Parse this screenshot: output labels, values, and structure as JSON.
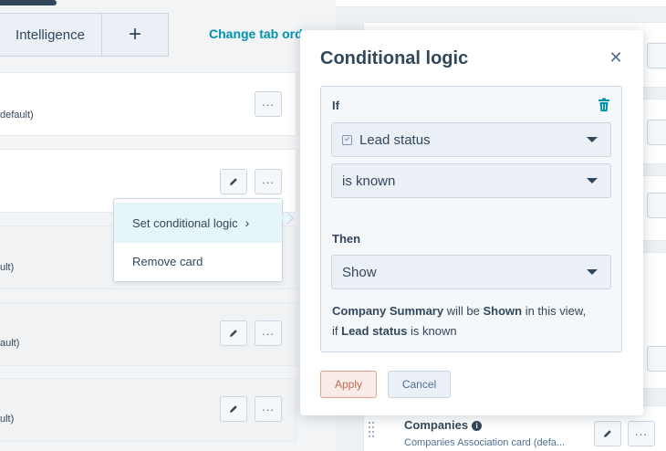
{
  "tabs": {
    "intelligence_label": "Intelligence",
    "add_label": "+",
    "change_order_label": "Change tab order"
  },
  "left_cards": [
    {
      "subtitle": "default)"
    },
    {
      "subtitle": ""
    },
    {
      "subtitle": "ult)"
    },
    {
      "subtitle": "ault)"
    },
    {
      "subtitle": "ult)"
    }
  ],
  "context_menu": {
    "items": [
      {
        "label": "Set conditional logic",
        "chevron": "›"
      },
      {
        "label": "Remove card"
      }
    ]
  },
  "dialog": {
    "title": "Conditional logic",
    "close_icon": "close-icon",
    "if_label": "If",
    "property_select": "Lead status",
    "condition_select": "is known",
    "then_label": "Then",
    "action_select": "Show",
    "summary": {
      "card_name": "Company Summary",
      "will_be": "will be",
      "shown": "Shown",
      "in_view": "in this view,",
      "if_word": "if",
      "property": "Lead status",
      "is_known": "is known"
    },
    "apply_label": "Apply",
    "cancel_label": "Cancel"
  },
  "right_card": {
    "title": "Companies",
    "subtitle": "Companies Association card (defa..."
  },
  "colors": {
    "link": "#0091ae",
    "text": "#33475b",
    "apply_border": "#e6a08e",
    "apply_text": "#c26a52"
  }
}
